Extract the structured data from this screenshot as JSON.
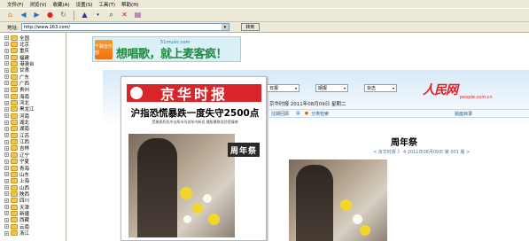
{
  "menu": [
    "文件(F)",
    "浏览(V)",
    "收藏(A)",
    "设置(S)",
    "工具(T)",
    "帮助(H)"
  ],
  "address": {
    "label": "地址:",
    "value": "http://www.163.com/",
    "go_label": "转到"
  },
  "sidebar": {
    "items": [
      "全国",
      "北京",
      "重庆",
      "福建",
      "港澳台",
      "甘肃",
      "广东",
      "广西",
      "贵州",
      "海南",
      "河北",
      "黑龙江",
      "河南",
      "湖北",
      "湖南",
      "江苏",
      "江西",
      "吉林",
      "辽宁",
      "宁夏",
      "青海",
      "山东",
      "上海",
      "山西",
      "陕西",
      "四川",
      "天津",
      "新疆",
      "西藏",
      "云南",
      "浙江"
    ]
  },
  "banner": {
    "logo_text": "千聊音乐部",
    "site": "51music.com",
    "slogan": "想唱歌，就上麦客疯！"
  },
  "newspaper": {
    "masthead": "京华时报",
    "headline": "沪指恐慌暴跌一度失守2500点",
    "subhead": "受美债危机冲击两市均创年内新低   穗股暴跌现恐慌情绪",
    "stamp": "周年祭"
  },
  "portal": {
    "selects": [
      "日报",
      "期报",
      "杂志"
    ],
    "brand": "人民网",
    "brand_url": "people.com.cn",
    "dateline": "京华时报 2011年08月09日 星期二",
    "tools": {
      "back": "往期回顾",
      "share": "分类检索",
      "catalog": "版面目录"
    },
    "article_title": "周年祭",
    "pager": "< 京华时报 》 4  2011年08月09日  第 001 版 >"
  }
}
